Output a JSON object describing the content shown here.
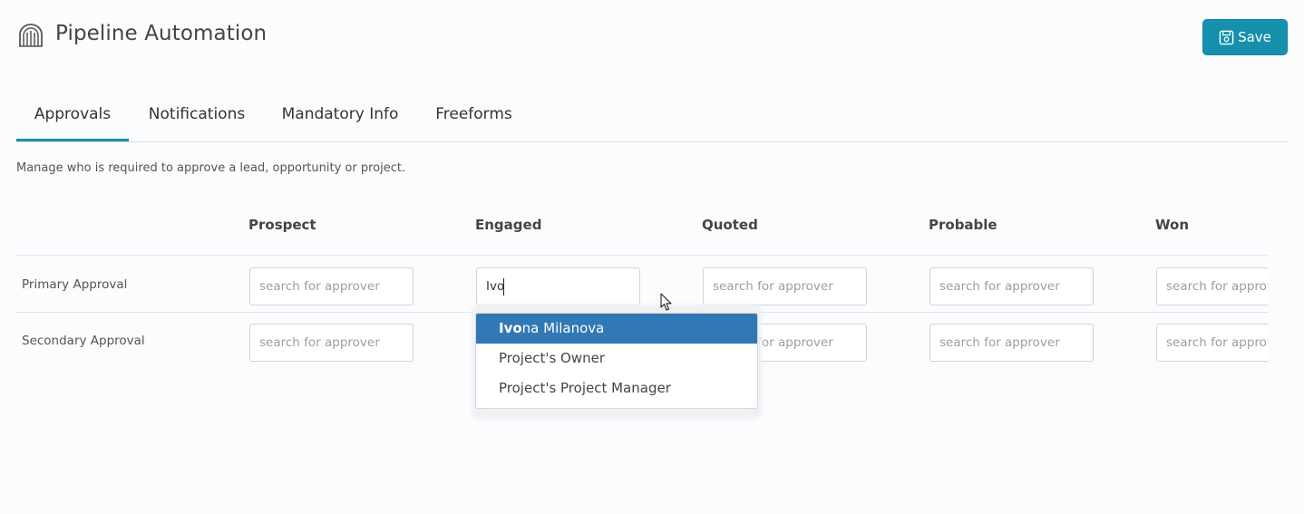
{
  "header": {
    "title": "Pipeline Automation",
    "icon": "pipeline-gate-icon",
    "save_label": "Save",
    "save_icon": "floppy-disk-icon",
    "accent_color": "#1590ad"
  },
  "tabs": [
    {
      "label": "Approvals",
      "active": true
    },
    {
      "label": "Notifications",
      "active": false
    },
    {
      "label": "Mandatory Info",
      "active": false
    },
    {
      "label": "Freeforms",
      "active": false
    }
  ],
  "description": "Manage who is required to approve a lead, opportunity or project.",
  "stages": [
    "Prospect",
    "Engaged",
    "Quoted",
    "Probable",
    "Won"
  ],
  "rows": [
    {
      "label": "Primary Approval"
    },
    {
      "label": "Secondary Approval"
    }
  ],
  "input_placeholder": "search for approver",
  "active_input": {
    "row": "Primary Approval",
    "stage": "Engaged",
    "value": "Ivo"
  },
  "dropdown": {
    "highlight_color": "#3178b5",
    "options": [
      {
        "match": "Ivo",
        "rest": "na Milanova",
        "highlighted": true
      },
      {
        "match": "",
        "rest": "Project's Owner",
        "highlighted": false
      },
      {
        "match": "",
        "rest": "Project's Project Manager",
        "highlighted": false
      }
    ]
  }
}
